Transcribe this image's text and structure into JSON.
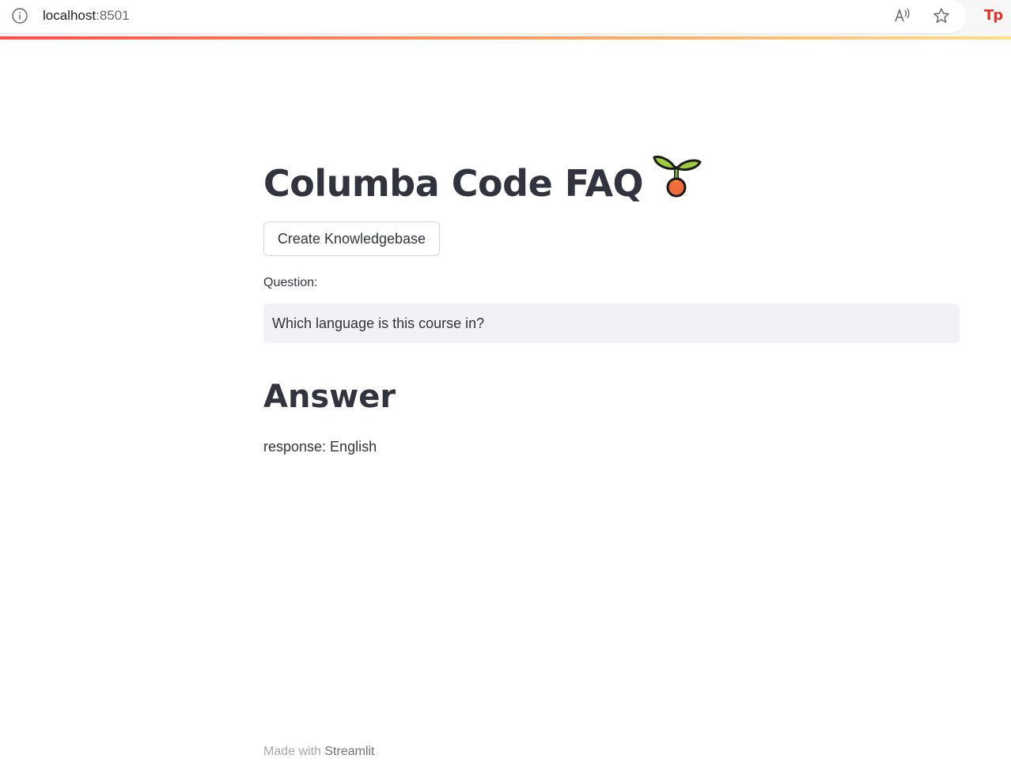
{
  "browser": {
    "url_host": "localhost",
    "url_port": ":8501",
    "icons": [
      "info-icon",
      "read-aloud-icon",
      "favorite-star-icon",
      "extension-icon"
    ],
    "extension_label": "Tp"
  },
  "main": {
    "title": "Columba Code FAQ",
    "title_emoji": "seedling",
    "create_button_label": "Create Knowledgebase",
    "question_label": "Question:",
    "question_value": "Which language is this course in?",
    "answer_heading": "Answer",
    "answer_text": "response: English"
  },
  "footer": {
    "prefix": "Made with ",
    "link": "Streamlit"
  },
  "colors": {
    "text": "#31333f",
    "input_bg": "#f0f2f6",
    "accent_gradient_start": "#ff4b4b",
    "accent_gradient_end": "#ffe08a",
    "extension_red": "#e5332a"
  }
}
